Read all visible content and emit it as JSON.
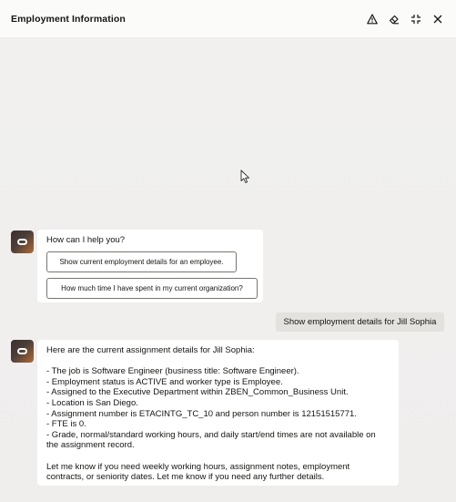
{
  "header": {
    "title": "Employment Information",
    "icons": [
      "warning-icon",
      "eraser-icon",
      "collapse-icon",
      "close-icon"
    ]
  },
  "chat": {
    "greeting": "How can I help you?",
    "suggestions": [
      "Show current employment details for an employee.",
      "How much time I have spent in my current organization?"
    ],
    "user_message": "Show employment details for Jill Sophia",
    "response": {
      "intro": "Here are the current assignment details for Jill Sophia:",
      "lines": [
        "- The job is Software Engineer (business title: Software Engineer).",
        "- Employment status is ACTIVE and worker type is Employee.",
        "- Assigned to the Executive Department within ZBEN_Common_Business Unit.",
        "- Location is San Diego.",
        "- Assignment number is ETACINTG_TC_10 and person number is 12151515771.",
        "- FTE is 0.",
        "- Grade, normal/standard working hours, and daily start/end times are not available on",
        "the assignment record."
      ],
      "closing": [
        "Let me know if you need weekly working hours, assignment notes, employment",
        "contracts, or seniority dates. Let me know if you need any further details."
      ]
    }
  },
  "colors": {
    "background": "#f2f1f0",
    "bubble": "#ffffff",
    "user_bubble": "#e4e2df",
    "avatar_accent": "#b36b35"
  }
}
